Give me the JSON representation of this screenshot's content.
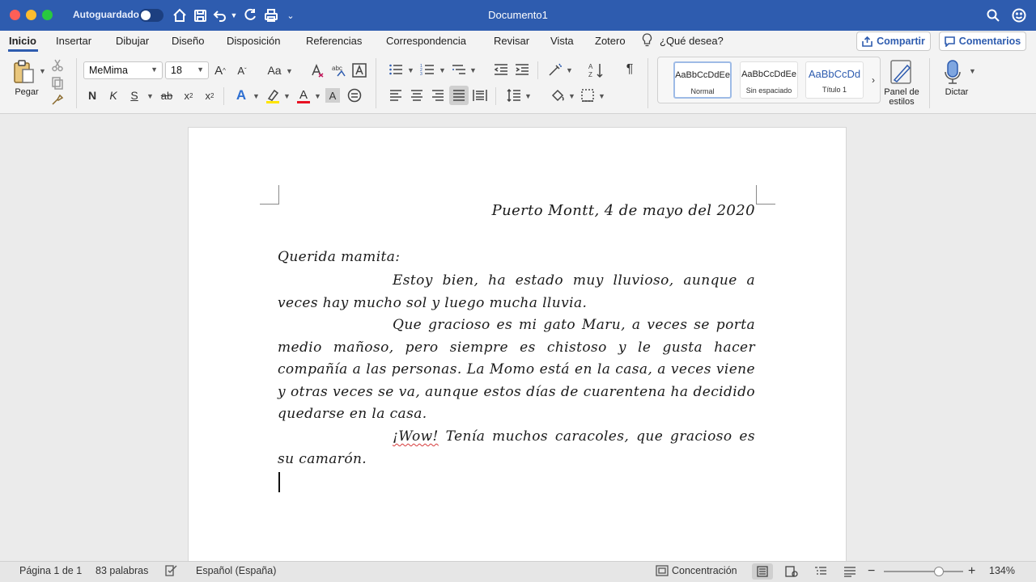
{
  "titlebar": {
    "autosave_label": "Autoguardado",
    "document_title": "Documento1"
  },
  "tabs": [
    {
      "label": "Inicio",
      "active": true
    },
    {
      "label": "Insertar"
    },
    {
      "label": "Dibujar"
    },
    {
      "label": "Diseño"
    },
    {
      "label": "Disposición"
    },
    {
      "label": "Referencias"
    },
    {
      "label": "Correspondencia"
    },
    {
      "label": "Revisar"
    },
    {
      "label": "Vista"
    },
    {
      "label": "Zotero"
    }
  ],
  "tell_me": "¿Qué desea?",
  "share_label": "Compartir",
  "comments_label": "Comentarios",
  "ribbon": {
    "paste_label": "Pegar",
    "font_name": "MeMima",
    "font_size": "18",
    "bold": "N",
    "italic": "K",
    "underline": "S",
    "strike": "ab",
    "grow_font": "A",
    "shrink_font": "A",
    "case": "Aa",
    "styles": [
      {
        "sample": "AaBbCcDdEe",
        "name": "Normal",
        "selected": true
      },
      {
        "sample": "AaBbCcDdEe",
        "name": "Sin espaciado"
      },
      {
        "sample": "AaBbCcDd",
        "name": "Título 1"
      }
    ],
    "styles_pane_label": "Panel de estilos",
    "dictate_label": "Dictar",
    "colors": {
      "highlight": "#ffe500",
      "font_color": "#e81123",
      "accent": "#2e5caf"
    }
  },
  "document": {
    "date_line": "Puerto Montt, 4 de mayo del 2020",
    "greeting": "Querida mamita:",
    "para1": "Estoy bien, ha estado muy lluvioso, aunque a veces hay mucho sol y luego mucha lluvia.",
    "para2": "Que gracioso es mi gato Maru, a veces se porta medio mañoso, pero siempre es chistoso y le gusta hacer compañía a las personas. La Momo está en la casa, a veces viene y otras veces se va, aunque estos días de cuarentena ha decidido quedarse en la casa.",
    "para3_flagged": "¡Wow!",
    "para3_rest": " Tenía muchos caracoles, que gracioso es su camarón."
  },
  "status": {
    "page": "Página 1 de 1",
    "words": "83 palabras",
    "language": "Español (España)",
    "focus": "Concentración",
    "zoom": "134%",
    "zoom_percent": 134
  }
}
